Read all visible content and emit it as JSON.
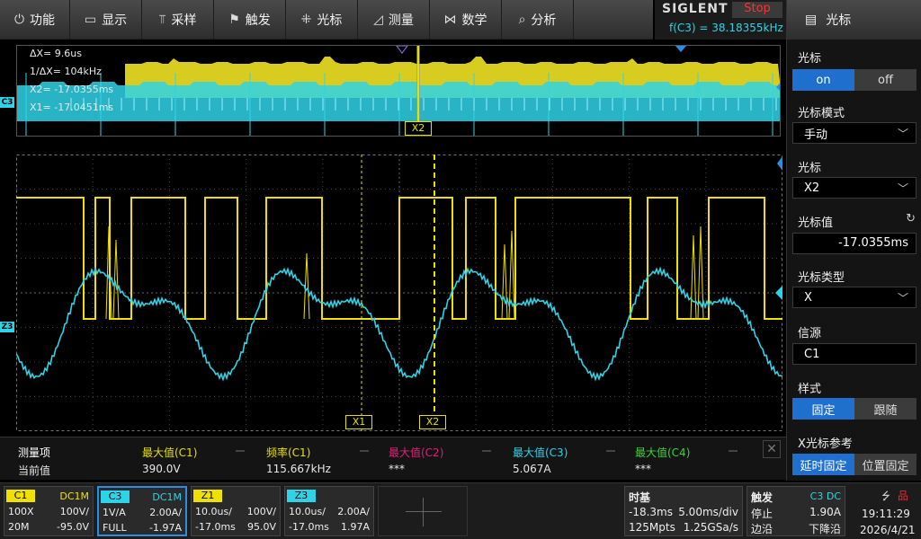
{
  "menu": [
    {
      "icon": "power-icon",
      "glyph": "⏻",
      "label": "功能"
    },
    {
      "icon": "display-icon",
      "glyph": "▭",
      "label": "显示"
    },
    {
      "icon": "acquire-icon",
      "glyph": "⫪",
      "label": "采样"
    },
    {
      "icon": "trigger-icon",
      "glyph": "⚑",
      "label": "触发"
    },
    {
      "icon": "cursor-icon",
      "glyph": "⁜",
      "label": "光标"
    },
    {
      "icon": "measure-icon",
      "glyph": "◿",
      "label": "测量"
    },
    {
      "icon": "math-icon",
      "glyph": "⋈",
      "label": "数学"
    },
    {
      "icon": "analysis-icon",
      "glyph": "⌕",
      "label": "分析"
    }
  ],
  "brand": {
    "logo": "SIGLENT",
    "status": "Stop",
    "freq": "f(C3) = 38.18355kHz"
  },
  "panel": {
    "title": "光标",
    "cursor_label": "光标",
    "cursor_on": "on",
    "cursor_off": "off",
    "mode_label": "光标模式",
    "mode_value": "手动",
    "cursor_sel_label": "光标",
    "cursor_sel_value": "X2",
    "value_label": "光标值",
    "value": "-17.0355ms",
    "type_label": "光标类型",
    "type_value": "X",
    "source_label": "信源",
    "source_value": "C1",
    "style_label": "样式",
    "style_fixed": "固定",
    "style_follow": "跟随",
    "xref_label": "X光标参考",
    "xref_delay": "延时固定",
    "xref_pos": "位置固定"
  },
  "overview": {
    "dx": "ΔX= 9.6us",
    "inv_dx": "1/ΔX= 104kHz",
    "x2": "X2= -17.0355ms",
    "x1": "X1= -17.0451ms",
    "x2_tag": "X2",
    "c3_marker": "C3"
  },
  "grid": {
    "x1_tag": "X1",
    "x2_tag": "X2",
    "z3_marker": "Z3"
  },
  "measure": {
    "headers": [
      "测量项",
      "最大值(C1)",
      "频率(C1)",
      "最大值(C2)",
      "最大值(C3)",
      "最大值(C4)"
    ],
    "row_label": "当前值",
    "values": [
      "390.0V",
      "115.667kHz",
      "***",
      "5.067A",
      "***"
    ],
    "colors": [
      "#ffffff",
      "#e6e000",
      "#e6e000",
      "#e0207a",
      "#2fd3e8",
      "#3cd23c"
    ]
  },
  "channels": [
    {
      "tag": "C1",
      "coupling": "DC1M",
      "tl": "100X",
      "tr": "100V/",
      "bl": "20M",
      "br": "-95.0V",
      "color": "#f0e000",
      "selected": false
    },
    {
      "tag": "C3",
      "coupling": "DC1M",
      "tl": "1V/A",
      "tr": "2.00A/",
      "bl": "FULL",
      "br": "-1.97A",
      "color": "#2fd3e8",
      "selected": true
    },
    {
      "tag": "Z1",
      "coupling": "",
      "tl": "10.0us/",
      "tr": "100V/",
      "bl": "-17.0ms",
      "br": "95.0V",
      "color": "#f0e000",
      "selected": false
    },
    {
      "tag": "Z3",
      "coupling": "",
      "tl": "10.0us/",
      "tr": "2.00A/",
      "bl": "-17.0ms",
      "br": "1.97A",
      "color": "#2fd3e8",
      "selected": false
    }
  ],
  "timebase": {
    "label": "时基",
    "delay": "-18.3ms",
    "scale": "5.00ms/div",
    "mpts": "125Mpts",
    "rate": "1.25GSa/s"
  },
  "trigger": {
    "label": "触发",
    "source": "C3 DC",
    "level": "1.90A",
    "state": "停止",
    "slope_label": "边沿",
    "slope": "下降沿"
  },
  "sys": {
    "time": "19:11:29",
    "date": "2026/4/21"
  }
}
